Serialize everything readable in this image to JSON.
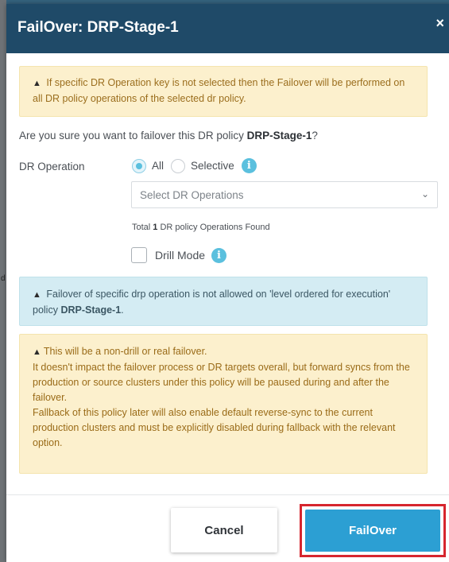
{
  "modal": {
    "title": "FailOver: DRP-Stage-1",
    "close_icon": "×",
    "warning_top": "If specific DR Operation key is not selected then the Failover will be performed on all DR policy operations of the selected dr policy.",
    "confirm_prefix": "Are you sure you want to failover this DR policy ",
    "confirm_policy": "DRP-Stage-1",
    "confirm_suffix": "?",
    "dr_operation_label": "DR Operation",
    "radio_all": "All",
    "radio_selective": "Selective",
    "selected_radio": "All",
    "select_placeholder": "Select DR Operations",
    "found_prefix": "Total ",
    "found_count": "1",
    "found_suffix": " DR policy Operations Found",
    "drill_mode_label": "Drill Mode",
    "drill_mode_checked": false,
    "info_alert_text": "Failover of specific drp operation is not allowed on 'level ordered for execution' policy ",
    "info_alert_policy": "DRP-Stage-1",
    "info_alert_suffix": ".",
    "nondrill_title": "This will be a non-drill or real failover.",
    "nondrill_para1": "It doesn't impact the failover process or DR targets overall, but forward syncs from the production or source clusters under this policy will be paused during and after the failover.",
    "nondrill_para2": "Fallback of this policy later will also enable default reverse-sync to the current production clusters and must be explicitly disabled during fallback with the relevant option.",
    "cancel_label": "Cancel",
    "failover_label": "FailOver"
  },
  "backdrop": {
    "edge_text": "d"
  },
  "colors": {
    "header": "#1f4a68",
    "primary_button": "#2c9fd3",
    "highlight_border": "#d6262e",
    "warning_bg": "#fcf0cd",
    "info_bg": "#d4ecf3",
    "accent": "#5bc0de"
  },
  "icons": {
    "close": "close-icon",
    "warning": "warning-triangle-icon",
    "info": "info-icon",
    "chevron": "chevron-down-icon"
  }
}
